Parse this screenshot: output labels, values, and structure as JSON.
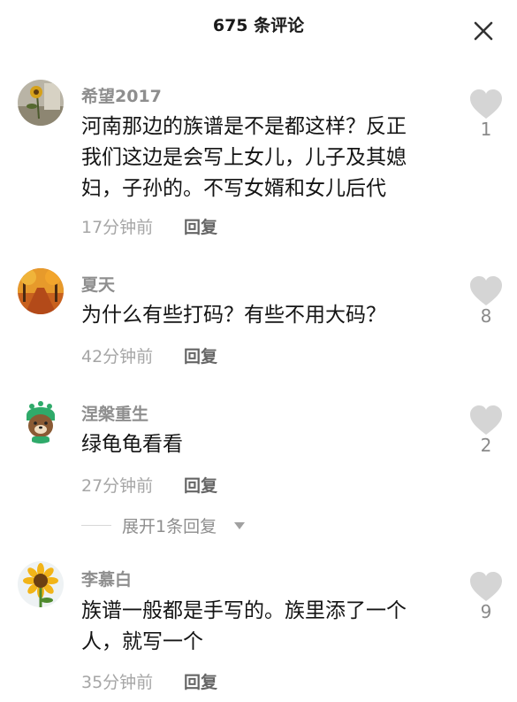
{
  "header": {
    "title": "675 条评论",
    "close_icon": "close-icon"
  },
  "colors": {
    "username": "#8e8e8e",
    "content": "#141414",
    "time": "#a6a6a6",
    "reply": "#666666",
    "heart": "#d5d5d5"
  },
  "comments": [
    {
      "username": "希望2017",
      "content_lines": [
        "河南那边的族谱是不是都这样？反正",
        "我们这边是会写上女儿，儿子及其媳",
        "妇，子孙的。不写女婿和女儿后代"
      ],
      "time": "17分钟前",
      "reply_label": "回复",
      "likes": "1",
      "avatar_icon": "sunflower-photo-icon"
    },
    {
      "username": "夏天",
      "content_lines": [
        "为什么有些打码？有些不用大码？"
      ],
      "time": "42分钟前",
      "reply_label": "回复",
      "likes": "8",
      "avatar_icon": "autumn-road-photo-icon"
    },
    {
      "username": "涅槃重生",
      "content_lines": [
        "绿龟龟看看"
      ],
      "time": "27分钟前",
      "reply_label": "回复",
      "likes": "2",
      "avatar_icon": "cartoon-bear-icon",
      "expand_replies_label": "展开1条回复"
    },
    {
      "username": "李慕白",
      "content_lines": [
        "族谱一般都是手写的。族里添了一个",
        "人，就写一个"
      ],
      "time": "35分钟前",
      "reply_label": "回复",
      "likes": "9",
      "avatar_icon": "sunflower-icon"
    }
  ]
}
